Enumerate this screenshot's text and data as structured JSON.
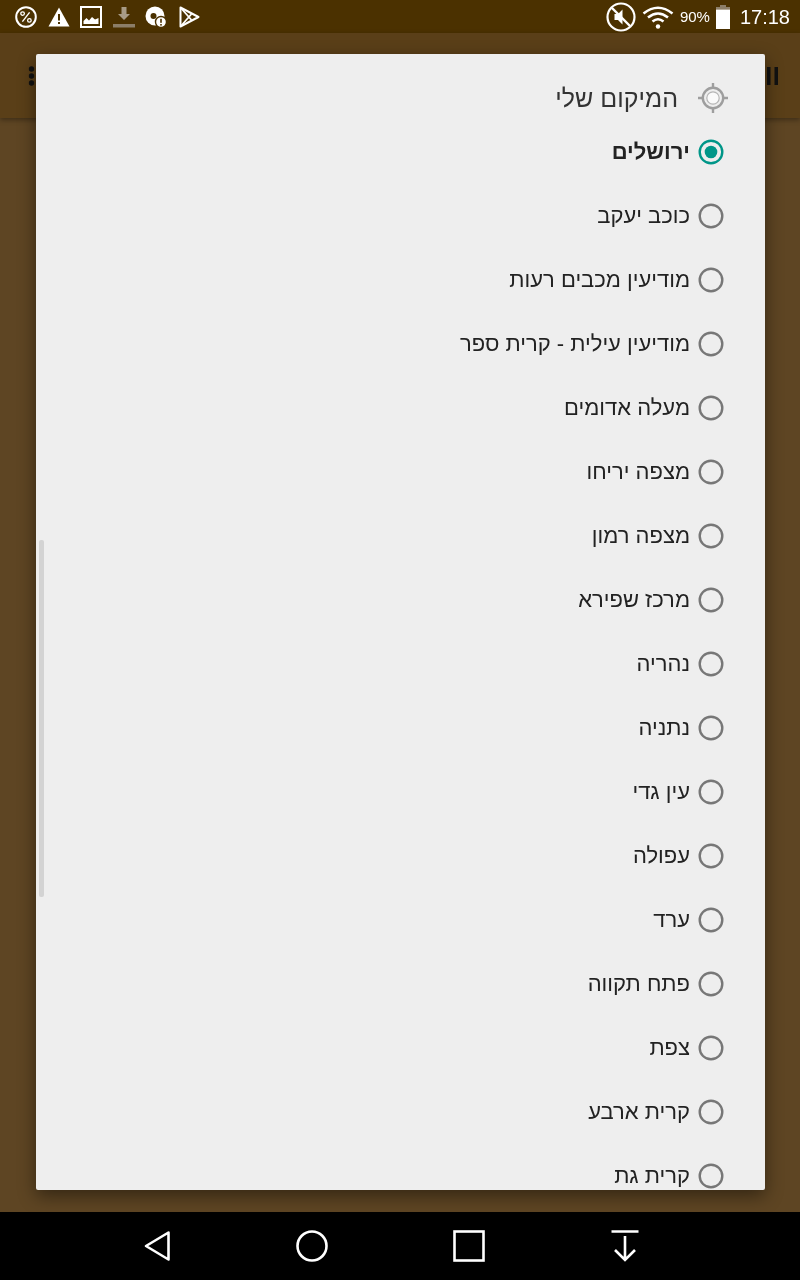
{
  "status_bar": {
    "battery_percent": "90%",
    "time": "17:18"
  },
  "dialog": {
    "title": "המיקום שלי",
    "options": [
      {
        "label": "ירושלים",
        "selected": true
      },
      {
        "label": "כוכב יעקב",
        "selected": false
      },
      {
        "label": "מודיעין מכבים רעות",
        "selected": false
      },
      {
        "label": "מודיעין עילית - קרית ספר",
        "selected": false
      },
      {
        "label": "מעלה אדומים",
        "selected": false
      },
      {
        "label": "מצפה יריחו",
        "selected": false
      },
      {
        "label": "מצפה רמון",
        "selected": false
      },
      {
        "label": "מרכז שפירא",
        "selected": false
      },
      {
        "label": "נהריה",
        "selected": false
      },
      {
        "label": "נתניה",
        "selected": false
      },
      {
        "label": "עין גדי",
        "selected": false
      },
      {
        "label": "עפולה",
        "selected": false
      },
      {
        "label": "ערד",
        "selected": false
      },
      {
        "label": "פתח תקווה",
        "selected": false
      },
      {
        "label": "צפת",
        "selected": false
      },
      {
        "label": "קרית ארבע",
        "selected": false
      },
      {
        "label": "קרית גת",
        "selected": false
      }
    ]
  }
}
